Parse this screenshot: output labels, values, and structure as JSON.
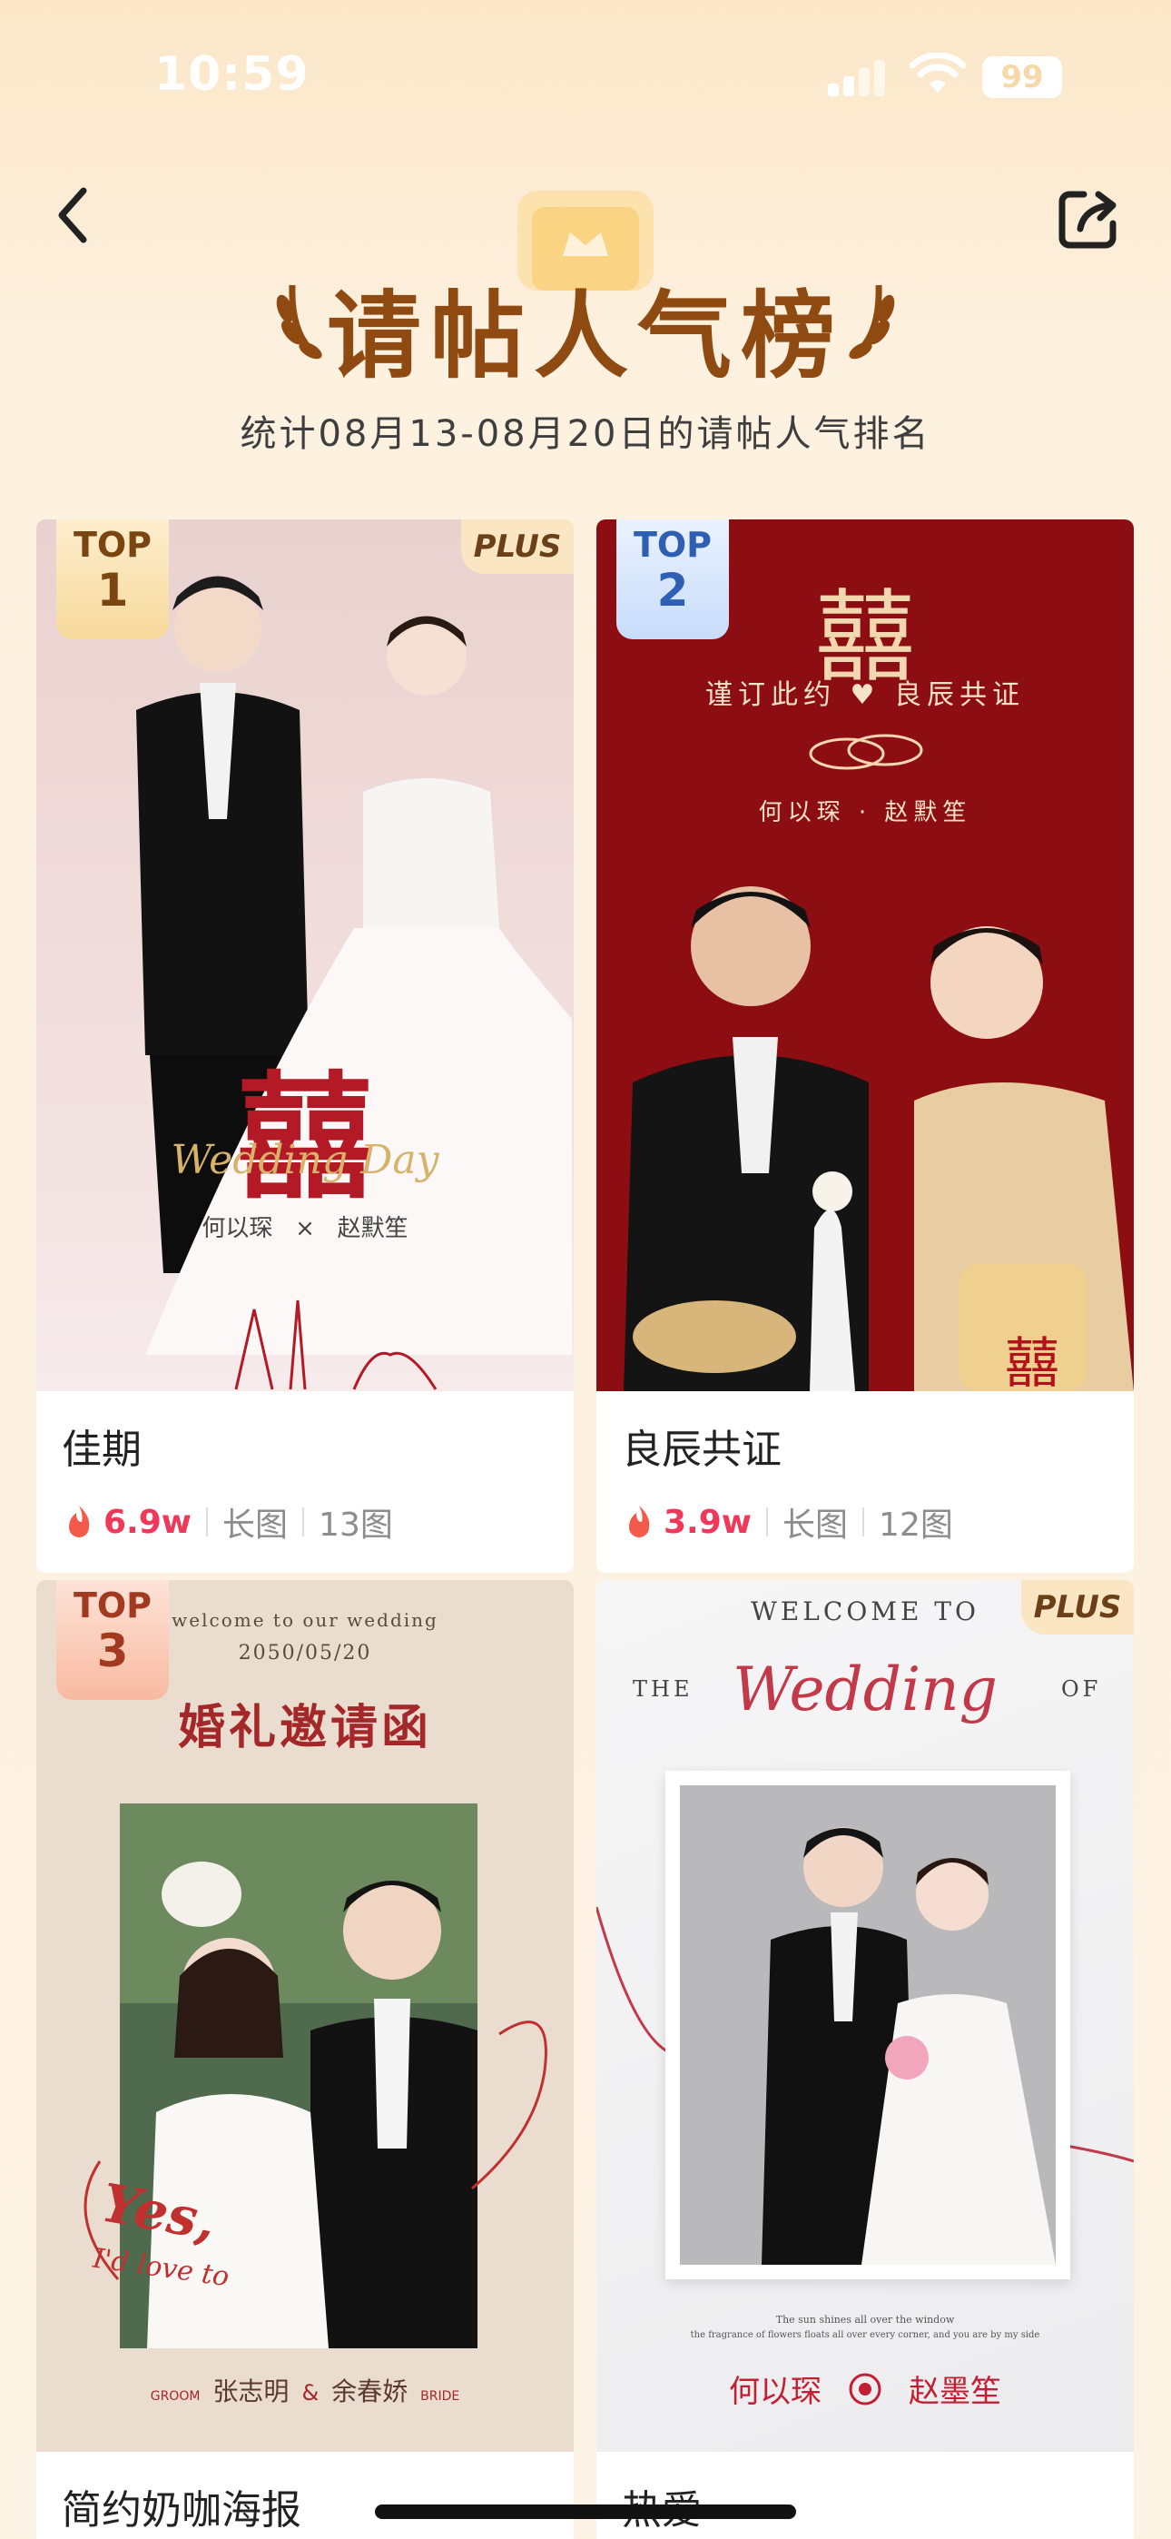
{
  "status_bar": {
    "time": "10:59",
    "battery": "99"
  },
  "header": {
    "title": "请帖人气榜",
    "subtitle": "统计08月13-08月20日的请帖人气排名"
  },
  "cards": [
    {
      "badge_top": "TOP",
      "badge_rank": "1",
      "plus": "PLUS",
      "title": "佳期",
      "heat": "6.9w",
      "format": "长图",
      "count": "13图",
      "poster": {
        "xi": "囍",
        "script": "Wedding Day",
        "names": "何以琛   ×   赵默笙"
      }
    },
    {
      "badge_top": "TOP",
      "badge_rank": "2",
      "title": "良辰共证",
      "heat": "3.9w",
      "format": "长图",
      "count": "12图",
      "poster": {
        "xi": "囍",
        "line": "谨订此约 ♥ 良辰共证",
        "names": "何以琛 · 赵默笙"
      }
    },
    {
      "badge_top": "TOP",
      "badge_rank": "3",
      "title": "简约奶咖海报",
      "poster": {
        "welcome": "welcome to our wedding",
        "date": "2050/05/20",
        "heading": "婚礼邀请函",
        "yes": "Yes,",
        "love": "I'd love to",
        "groom_label": "GROOM",
        "groom": "张志明",
        "amp": "&",
        "bride": "余春娇",
        "bride_label": "BRIDE"
      }
    },
    {
      "plus": "PLUS",
      "title": "热爱",
      "poster": {
        "welcome": "WELCOME TO",
        "the": "THE",
        "wedding": "Wedding",
        "of": "OF",
        "line1": "The sun shines all over the window",
        "line2": "the fragrance of flowers floats all over every corner, and you are by my side",
        "name1": "何以琛",
        "name2": "赵墨笙"
      }
    }
  ]
}
